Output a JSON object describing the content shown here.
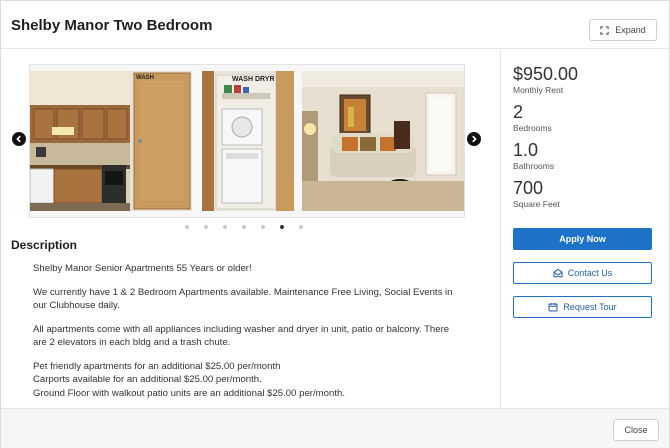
{
  "header": {
    "title": "Shelby Manor Two Bedroom",
    "expand_label": "Expand",
    "expand_icon": "expand-icon"
  },
  "gallery": {
    "prev_icon": "chevron-left-icon",
    "next_icon": "chevron-right-icon",
    "photos": [
      {
        "name": "kitchen-photo",
        "sign_text": "WASH"
      },
      {
        "name": "laundry-closet-photo",
        "sign_text": "WASH DRYR"
      },
      {
        "name": "living-room-photo"
      }
    ],
    "dot_count": 7,
    "active_dot": 5
  },
  "description": {
    "heading": "Description",
    "paragraphs": [
      [
        "Shelby Manor Senior Apartments 55 Years or older!"
      ],
      [
        "We currently have 1 & 2 Bedroom Apartments available. Maintenance Free Living, Social Events in",
        "our Clubhouse daily."
      ],
      [
        "All apartments come with all appliances including washer and dryer in unit, patio or balcony. There",
        "are 2 elevators in each bldg and a trash chute."
      ],
      [
        "Pet friendly apartments for an additional $25.00 per/month",
        "Carports available for an additional $25.00 per/month.",
        "Ground Floor with walkout patio units are an additional $25.00 per/month."
      ]
    ]
  },
  "stats": {
    "rent": {
      "value": "$950.00",
      "label": "Monthly Rent"
    },
    "bedrooms": {
      "value": "2",
      "label": "Bedrooms"
    },
    "bathrooms": {
      "value": "1.0",
      "label": "Bathrooms"
    },
    "sqft": {
      "value": "700",
      "label": "Square Feet"
    }
  },
  "actions": {
    "apply_label": "Apply Now",
    "contact_label": "Contact Us",
    "contact_icon": "mail-icon",
    "tour_label": "Request Tour",
    "tour_icon": "calendar-icon"
  },
  "footer": {
    "close_label": "Close"
  },
  "colors": {
    "accent": "#1e73c8",
    "text": "#2b2b2b"
  }
}
